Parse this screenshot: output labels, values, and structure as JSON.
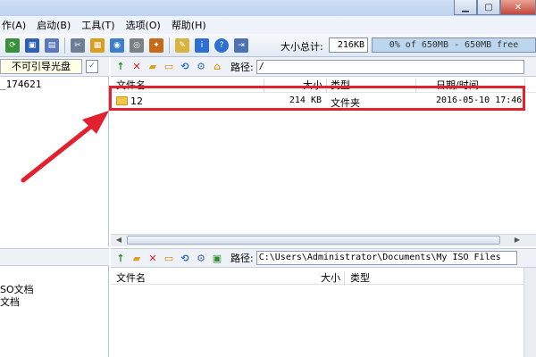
{
  "menu": {
    "items": [
      "作(A)",
      "启动(B)",
      "工具(T)",
      "选项(O)",
      "帮助(H)"
    ]
  },
  "toolbar": {
    "size_label": "大小总计:",
    "size_value": "216KB",
    "capacity_text": "0% of 650MB - 650MB free"
  },
  "left_top": {
    "boot_label": "不可引导光盘",
    "tree_node": "_174621"
  },
  "left_bottom": {
    "items": [
      "SO文档",
      "文档"
    ]
  },
  "right_top": {
    "path_label": "路径:",
    "path_value": "/",
    "columns": {
      "name": "文件名",
      "size": "大小",
      "type": "类型",
      "modified": "日期/时间"
    },
    "rows": [
      {
        "name": "12",
        "size": "214 KB",
        "type": "文件夹",
        "modified": "2016-05-10 17:46"
      }
    ]
  },
  "right_bottom": {
    "path_label": "路径:",
    "path_value": "C:\\Users\\Administrator\\Documents\\My ISO Files",
    "columns": {
      "name": "文件名",
      "size": "大小",
      "type": "类型"
    }
  },
  "colors": {
    "highlight": "#e3202d",
    "arrow": "#e3202d"
  }
}
